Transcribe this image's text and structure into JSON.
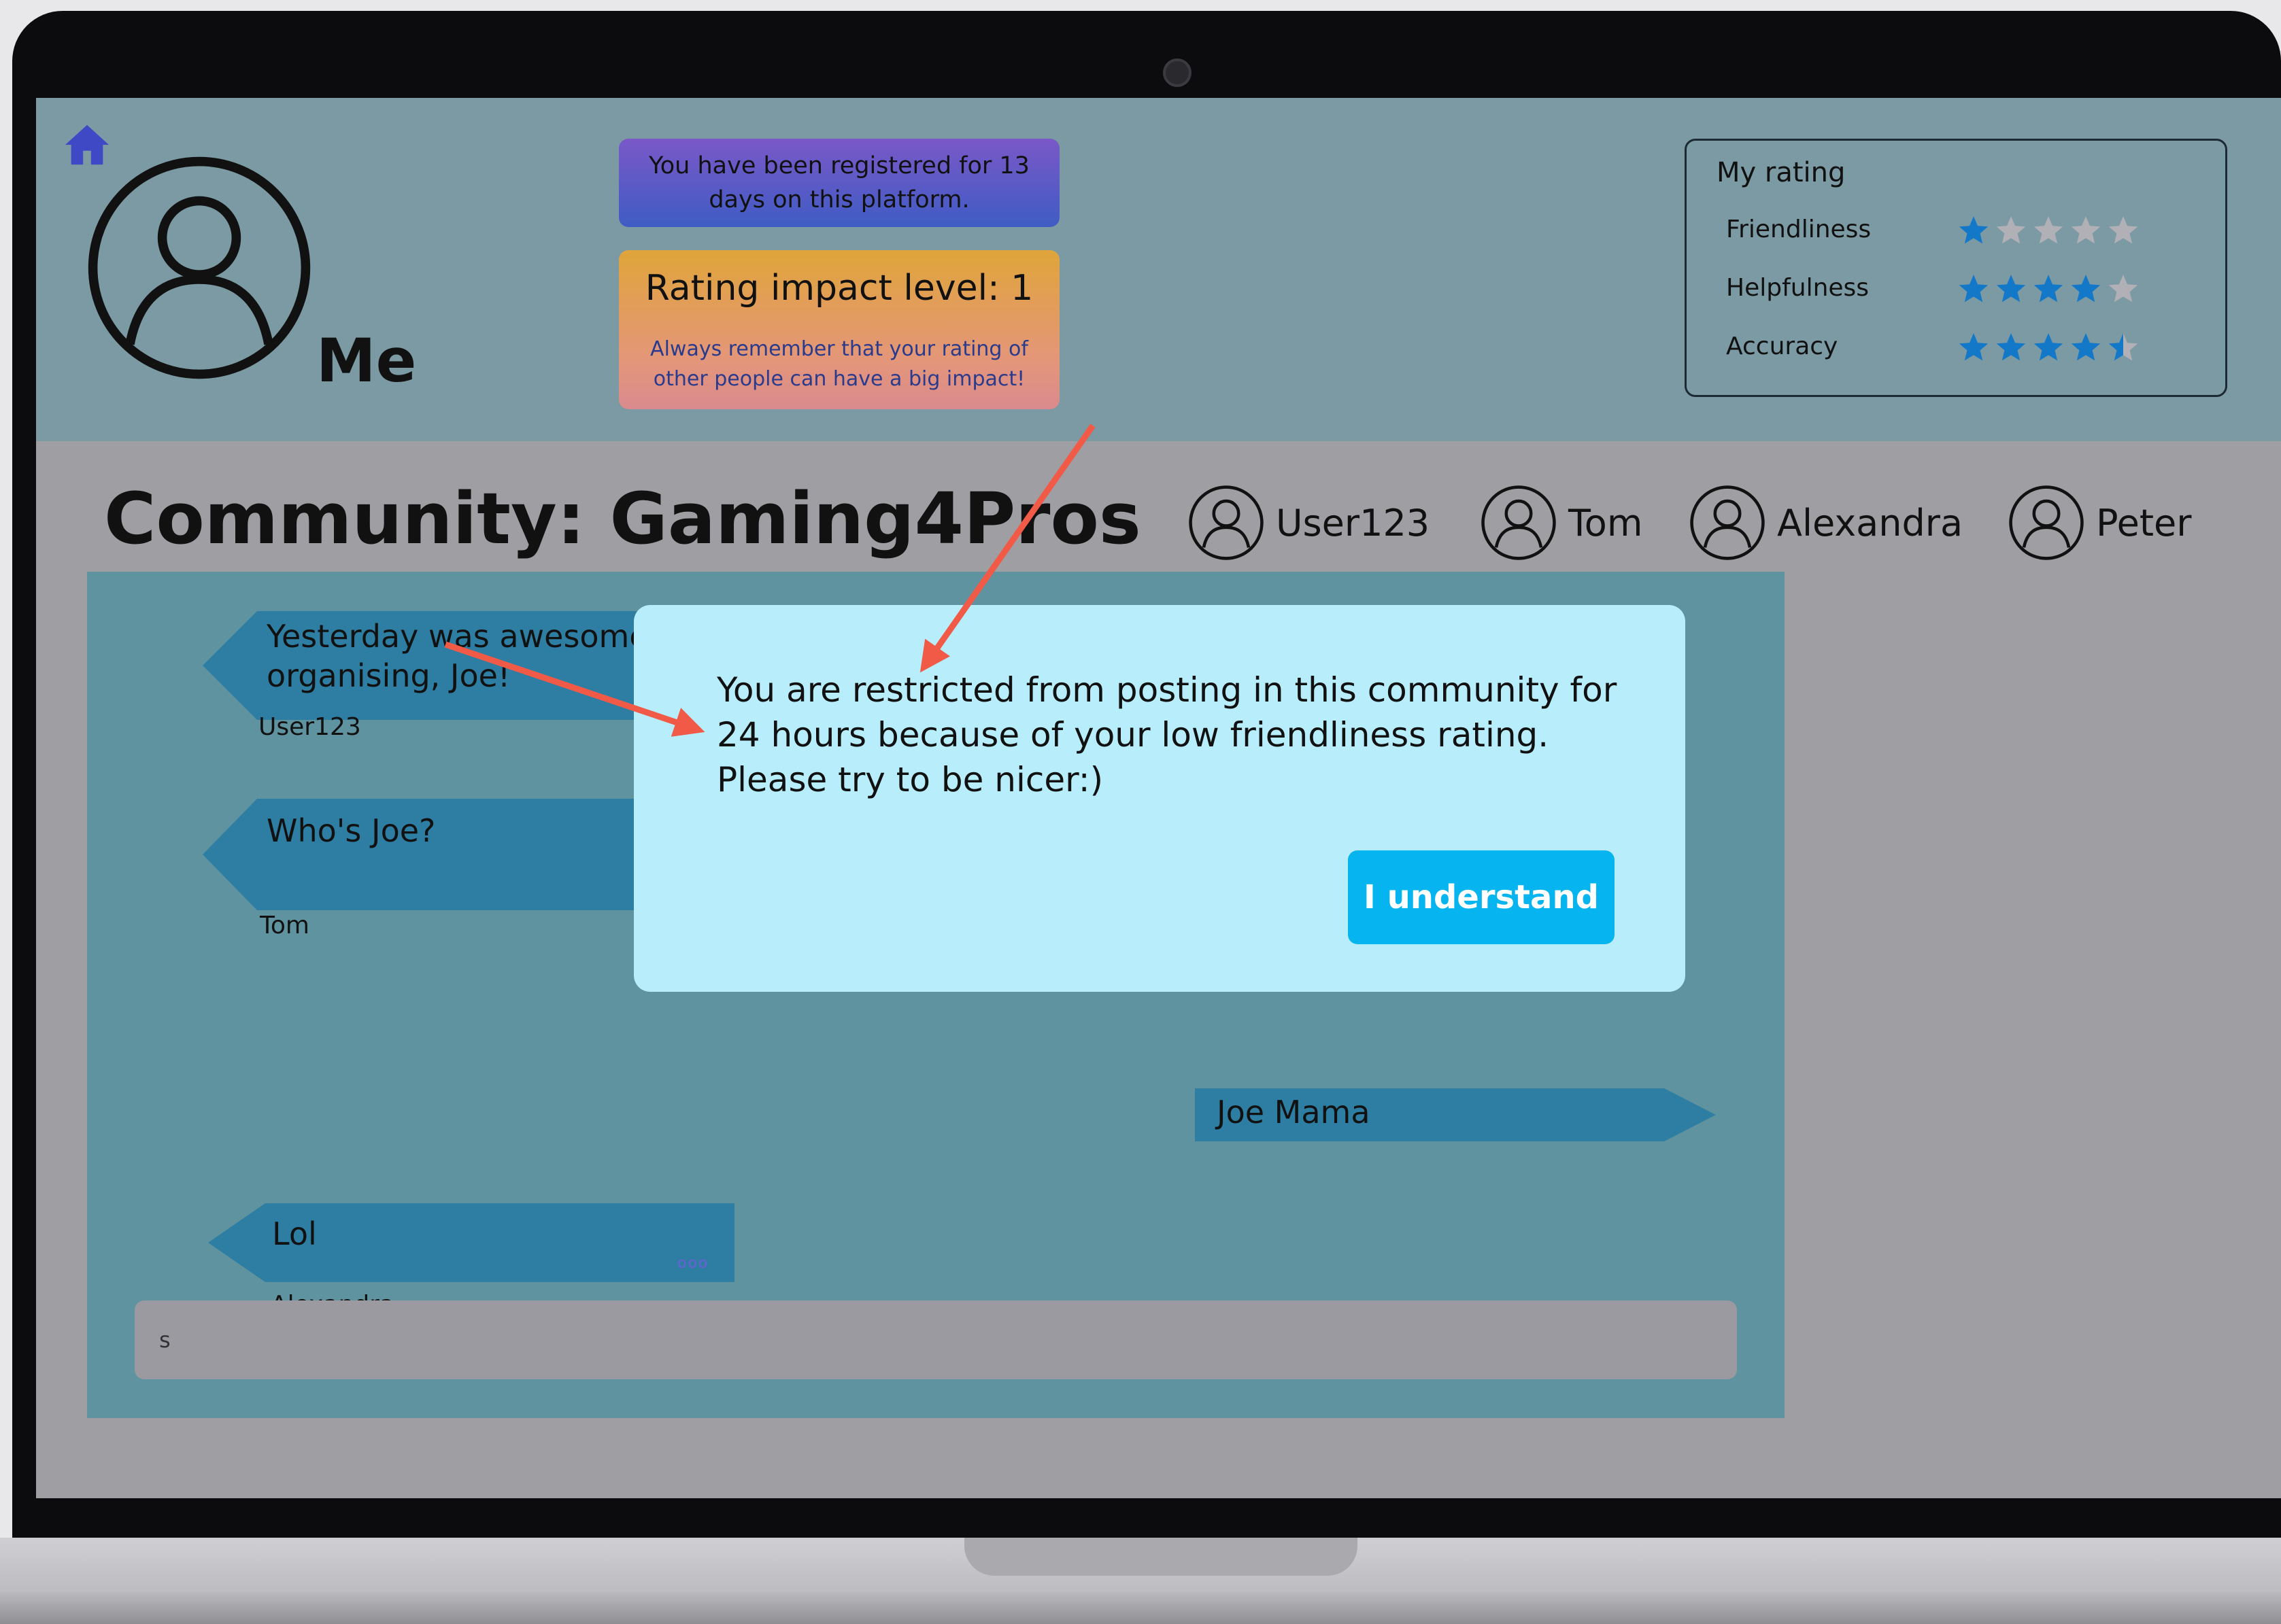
{
  "header": {
    "me_label": "Me",
    "registered_text": "You have been registered for 13 days on this platform.",
    "impact_title": "Rating impact level: 1",
    "impact_note": "Always remember that your rating of other people can have a big impact!"
  },
  "rating": {
    "title": "My rating",
    "rows": [
      {
        "label": "Friendliness",
        "value": 1,
        "max": 5
      },
      {
        "label": "Helpfulness",
        "value": 4,
        "max": 5
      },
      {
        "label": "Accuracy",
        "value": 4.5,
        "max": 5
      }
    ]
  },
  "community": {
    "title": "Community: Gaming4Pros",
    "members": [
      "User123",
      "Tom",
      "Alexandra",
      "Peter"
    ]
  },
  "chat": {
    "messages": [
      {
        "line1": "Yesterday was awesome! Th",
        "line2": "organising, Joe!",
        "sender": "User123"
      },
      {
        "line1": "Who's Joe?",
        "sender": "Tom"
      },
      {
        "line1": "Joe Mama"
      },
      {
        "line1": "Lol",
        "sender": "Alexandra",
        "more": "ooo"
      }
    ],
    "input_value": "s"
  },
  "modal": {
    "message": "You are restricted from posting in this community for 24 hours because of your low friendliness rating. Please try to be nicer:)",
    "button_label": "I understand"
  },
  "colors": {
    "header_bg": "#7b9aa3",
    "screen_dim": "#9f9ea3",
    "chat_panel": "#5f93a0",
    "bubble": "#2e7ea3",
    "modal_bg": "#b8eefb",
    "button": "#06b4ef",
    "star_on": "#1478c8",
    "star_off": "#b0b0b6",
    "annotation_arrow": "#f25a48",
    "home_icon": "#3f49c6"
  },
  "icons": [
    "home-icon",
    "avatar-icon",
    "user-avatar-icon",
    "star-icon"
  ]
}
